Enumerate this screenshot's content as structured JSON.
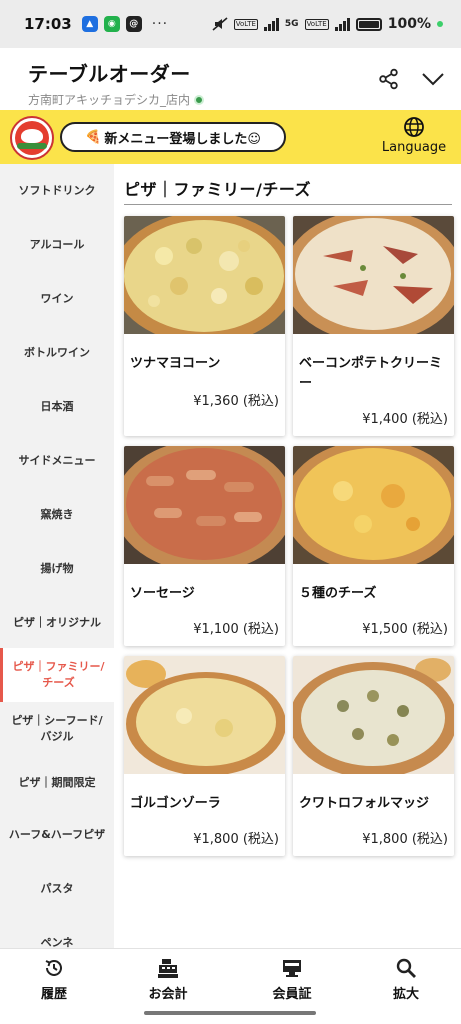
{
  "status_bar": {
    "time": "17:03",
    "dots": "···",
    "battery": "100%",
    "net_5g": "5G",
    "tag1": "VoLTE",
    "tag2": "VoLTE"
  },
  "header": {
    "title": "テーブルオーダー",
    "subtitle": "方南町アキッチョデシカ_店内"
  },
  "banner": {
    "announcement": "新メニュー登場しました☺",
    "language_label": "Language"
  },
  "sidebar": {
    "items": [
      "ソフトドリンク",
      "アルコール",
      "ワイン",
      "ボトルワイン",
      "日本酒",
      "サイドメニュー",
      "窯焼き",
      "揚げ物",
      "ピザ｜オリジナル",
      "ピザ｜ファミリー/チーズ",
      "ピザ｜シーフード/バジル",
      "ピザ｜期間限定",
      "ハーフ&ハーフピザ",
      "パスタ",
      "ペンネ"
    ],
    "active_index": 9
  },
  "section": {
    "title": "ピザ｜ファミリー/チーズ"
  },
  "products": [
    {
      "name": "ツナマヨコーン",
      "price": "¥1,360 (税込)"
    },
    {
      "name": "ベーコンポテトクリーミー",
      "price": "¥1,400 (税込)"
    },
    {
      "name": "ソーセージ",
      "price": "¥1,100 (税込)"
    },
    {
      "name": "５種のチーズ",
      "price": "¥1,500 (税込)"
    },
    {
      "name": "ゴルゴンゾーラ",
      "price": "¥1,800 (税込)"
    },
    {
      "name": "クワトロフォルマッジ",
      "price": "¥1,800 (税込)"
    }
  ],
  "bottom_nav": [
    {
      "label": "履歴",
      "icon": "history-icon"
    },
    {
      "label": "お会計",
      "icon": "register-icon"
    },
    {
      "label": "会員証",
      "icon": "membership-card-icon"
    },
    {
      "label": "拡大",
      "icon": "zoom-icon"
    }
  ],
  "colors": {
    "accent": "#e6584b",
    "banner": "#fbe34a",
    "sidebar_bg": "#f2f2f2"
  }
}
